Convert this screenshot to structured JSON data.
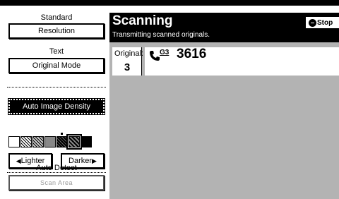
{
  "left_panel": {
    "resolution_label": "Standard",
    "resolution_button": "Resolution",
    "original_mode_label": "Text",
    "original_mode_button": "Original Mode",
    "density_button": "Auto Image Density",
    "density_level": 5,
    "density_steps": 7,
    "lighter_button": "Lighter",
    "darker_button": "Darker",
    "scan_area_label": "Auto Detect",
    "scan_area_button": "Scan Area"
  },
  "main": {
    "title": "Scanning",
    "subtitle": "Transmitting scanned originals.",
    "stop_button": "Stop",
    "original_label": "Original:",
    "original_count": "3",
    "destination_mode": "G3",
    "destination_number": "3616"
  },
  "icons": {
    "phone": "phone-icon",
    "stop": "stop-icon",
    "arrow_left": "arrow-left-icon",
    "arrow_right": "arrow-right-icon"
  }
}
